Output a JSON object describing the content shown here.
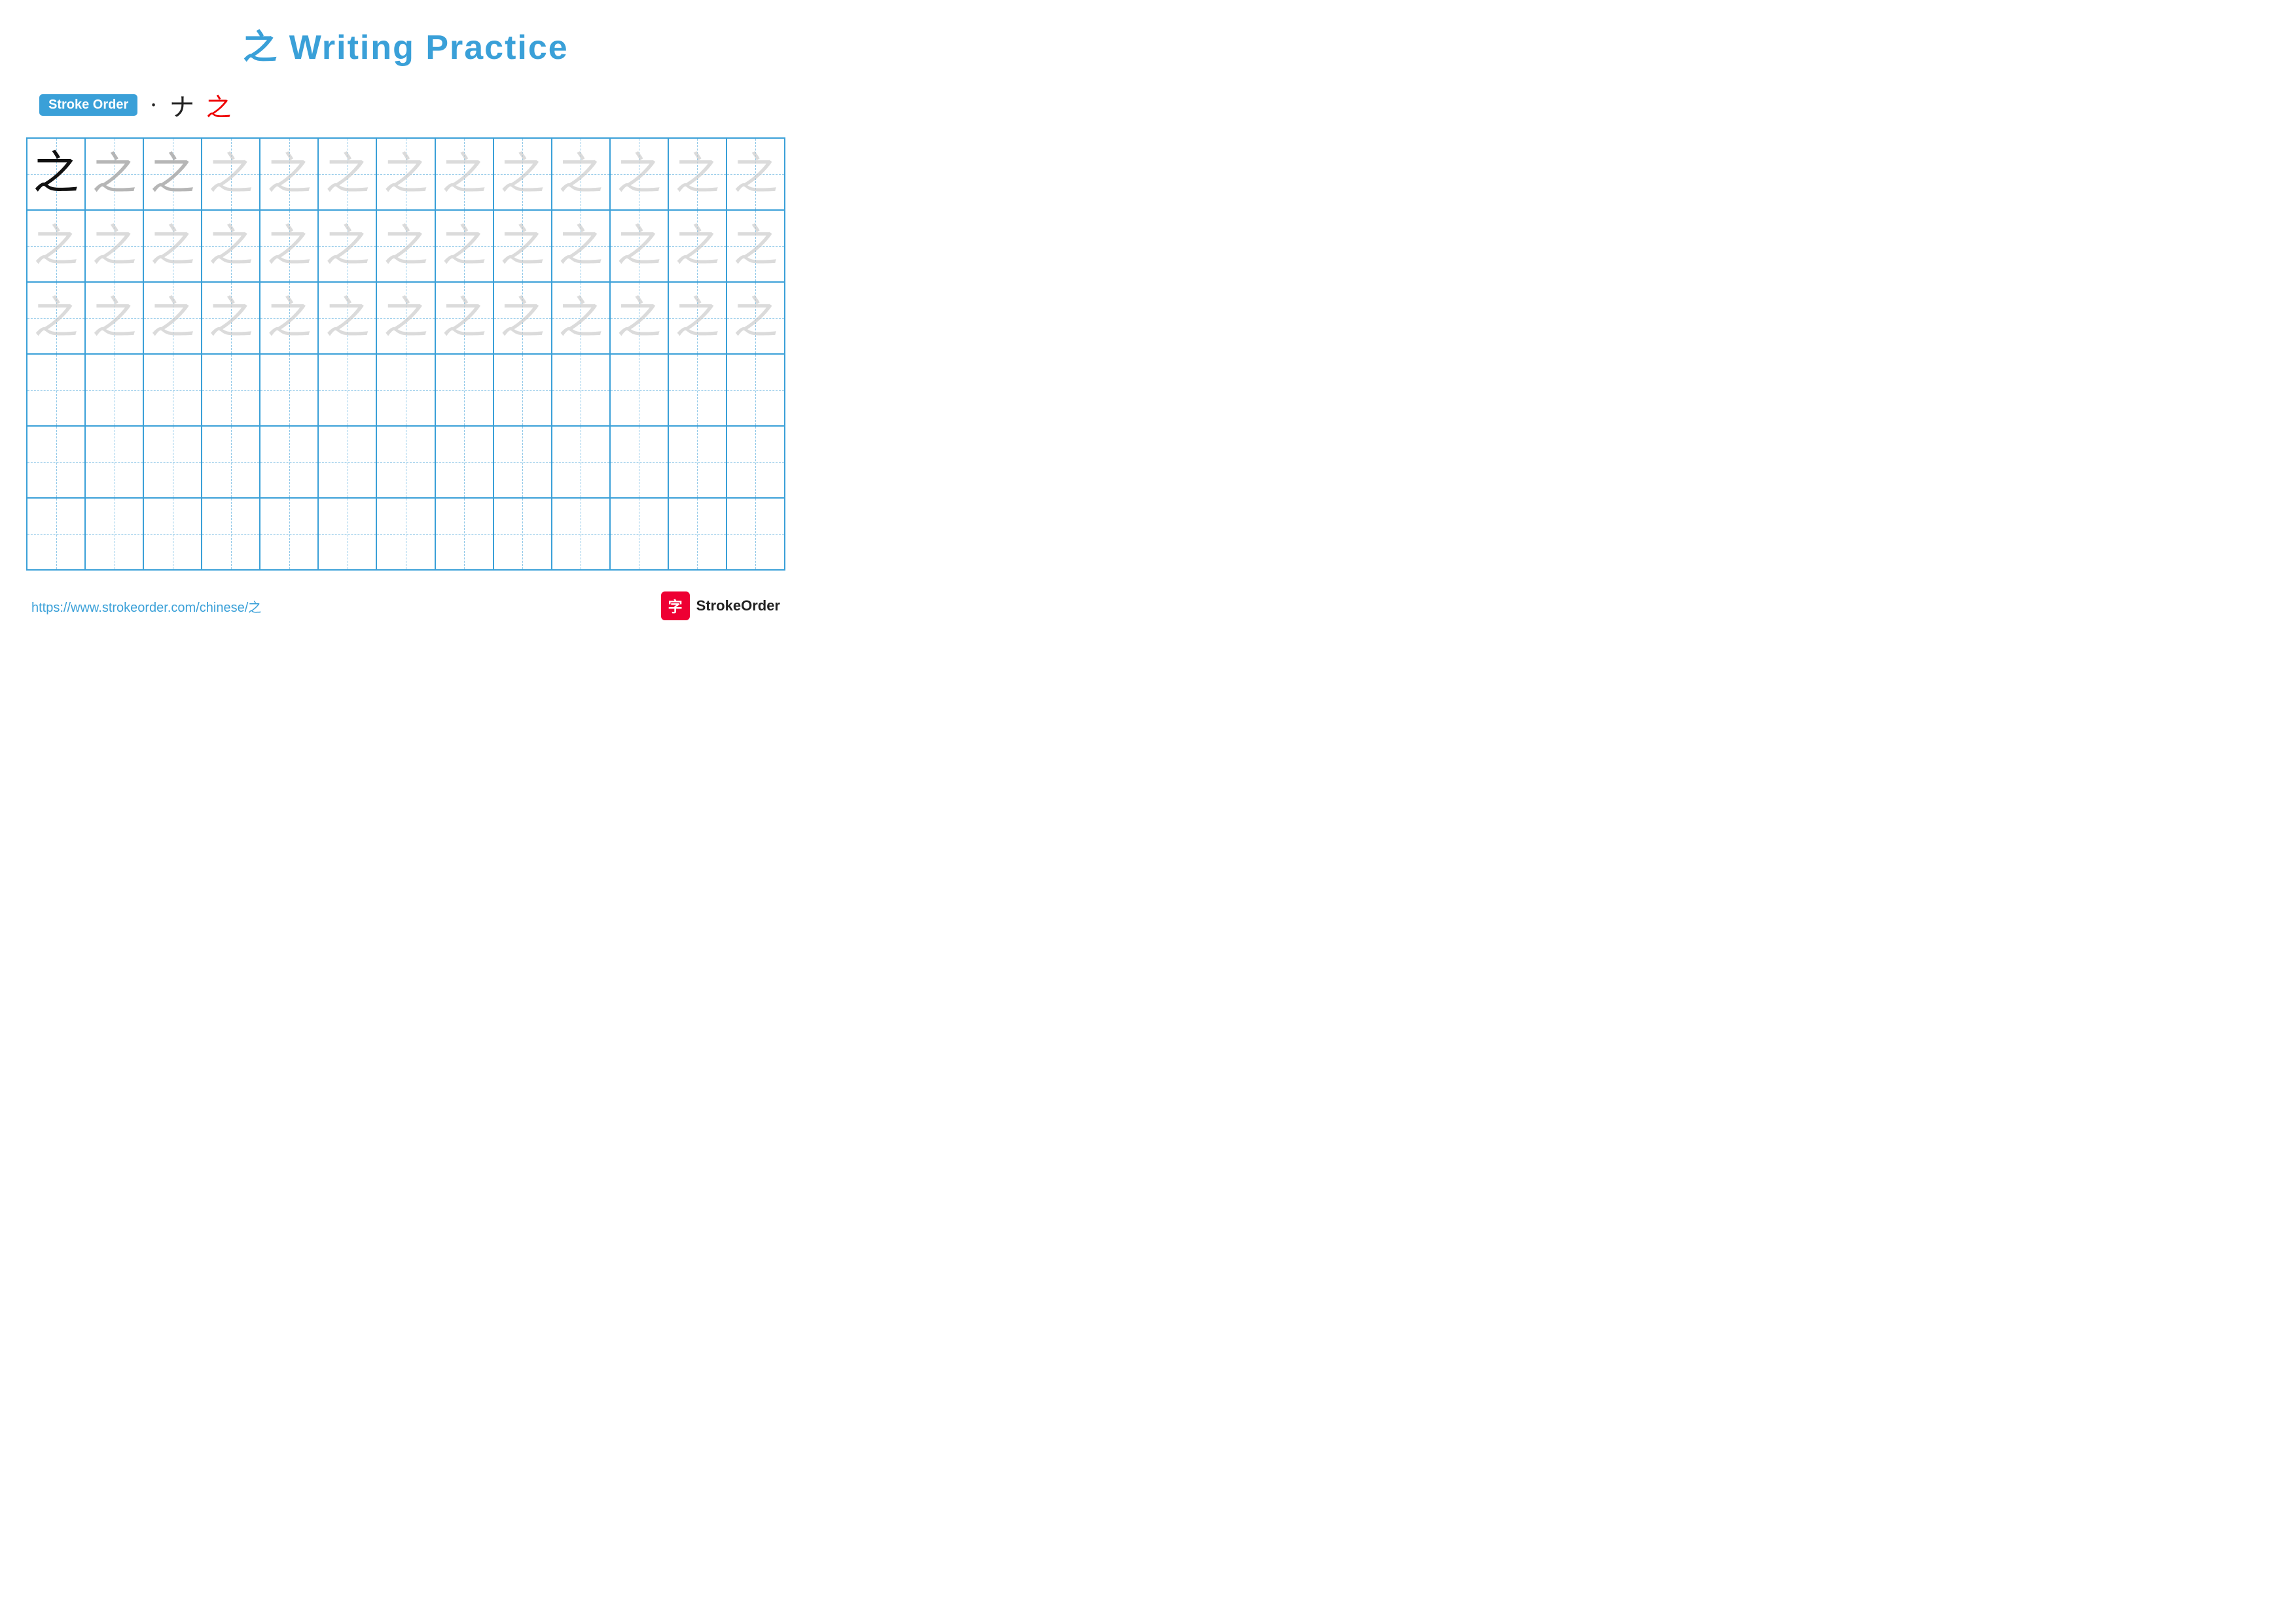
{
  "title": {
    "char": "之",
    "text": "Writing Practice"
  },
  "stroke_order": {
    "label": "Stroke Order",
    "strokes": [
      "·",
      "ナ",
      "之"
    ]
  },
  "grid": {
    "rows": 6,
    "cols": 13,
    "example_char": "之",
    "ghost_rows": 3,
    "empty_rows": 3
  },
  "footer": {
    "url": "https://www.strokeorder.com/chinese/之",
    "brand_char": "字",
    "brand_name": "StrokeOrder"
  }
}
